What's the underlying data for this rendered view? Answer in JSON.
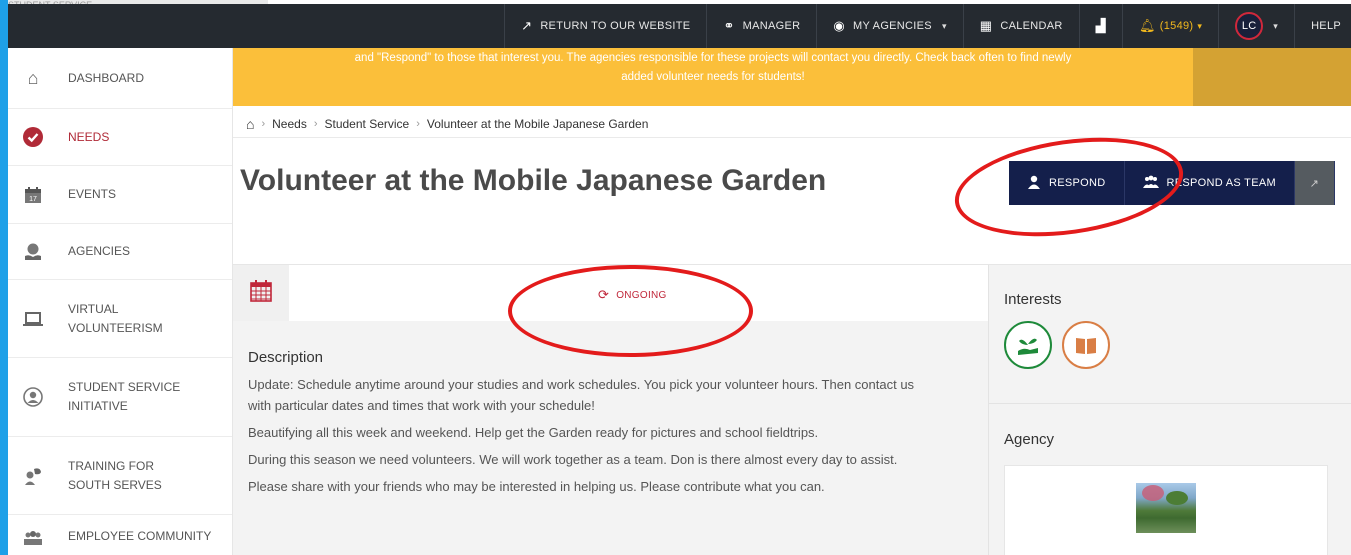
{
  "ghost_tab": "STUDENT SERVICE",
  "topbar": {
    "return_label": "RETURN TO OUR WEBSITE",
    "manager_label": "MANAGER",
    "agencies_label": "MY AGENCIES",
    "calendar_label": "CALENDAR",
    "notifications_label": "(1549)",
    "avatar_initials": "LC",
    "help_label": "HELP"
  },
  "sidebar": {
    "items": [
      {
        "label": "DASHBOARD",
        "icon": "home-icon",
        "active": false
      },
      {
        "label": "NEEDS",
        "icon": "check-circle-icon",
        "active": true
      },
      {
        "label": "EVENTS",
        "icon": "calendar-17-icon",
        "active": false
      },
      {
        "label": "AGENCIES",
        "icon": "hand-globe-icon",
        "active": false
      },
      {
        "label": "VIRTUAL VOLUNTEERISM",
        "icon": "laptop-icon",
        "active": false
      },
      {
        "label": "STUDENT SERVICE INITIATIVE",
        "icon": "user-circle-icon",
        "active": false
      },
      {
        "label": "TRAINING FOR SOUTH SERVES",
        "icon": "trainer-icon",
        "active": false
      },
      {
        "label": "EMPLOYEE COMMUNITY",
        "icon": "group-icon",
        "active": false
      }
    ]
  },
  "banner": {
    "line1": "and \"Respond\" to those that interest you. The agencies responsible for these projects will contact you directly.  Check back often to find newly",
    "line2": "added volunteer needs for students!"
  },
  "breadcrumb": {
    "items": [
      "Needs",
      "Student Service",
      "Volunteer at the Mobile Japanese Garden"
    ]
  },
  "page": {
    "title": "Volunteer at the Mobile Japanese Garden",
    "respond_label": "RESPOND",
    "respond_team_label": "RESPOND AS TEAM",
    "status": "ONGOING"
  },
  "description": {
    "heading": "Description",
    "paragraphs": [
      "Update: Schedule anytime around your studies and work schedules. You pick your volunteer hours. Then contact us with particular dates and times that work with your schedule!",
      "Beautifying all this week and weekend. Help get the Garden ready for pictures and school fieldtrips.",
      "During this season we need volunteers.  We will work together as a team.  Don is there almost every day to assist.",
      "Please share with your friends who may be interested in helping us.  Please contribute what you can."
    ]
  },
  "right": {
    "interests_heading": "Interests",
    "interests": [
      {
        "icon": "plant-hand-icon",
        "color": "#1e8a3a"
      },
      {
        "icon": "book-icon",
        "color": "#d97e45"
      }
    ],
    "agency_heading": "Agency"
  },
  "colors": {
    "topbar": "#252a30",
    "banner": "#fbbf3a",
    "accent_red": "#b02a37",
    "button_navy": "#141f4b",
    "annotation_red": "#e31b1b"
  }
}
